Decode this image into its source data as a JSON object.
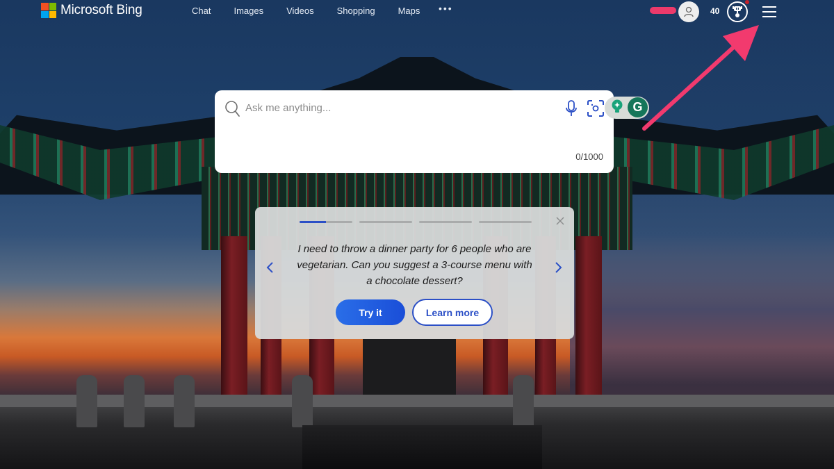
{
  "header": {
    "brand": "Microsoft Bing",
    "logo_colors": [
      "#f25022",
      "#7fba00",
      "#00a4ef",
      "#ffb900"
    ],
    "nav": [
      {
        "label": "Chat"
      },
      {
        "label": "Images"
      },
      {
        "label": "Videos"
      },
      {
        "label": "Shopping"
      },
      {
        "label": "Maps"
      }
    ],
    "more_label": "•••",
    "rewards_points": "40",
    "icons": {
      "avatar": "person-icon",
      "rewards": "trophy-icon",
      "menu": "hamburger-menu-icon"
    }
  },
  "search": {
    "placeholder": "Ask me anything...",
    "value": "",
    "char_count": "0/1000",
    "icons": {
      "search": "search-icon",
      "mic": "microphone-icon",
      "visual": "visual-search-icon"
    }
  },
  "extension": {
    "name": "Grammarly",
    "letter": "G",
    "color": "#15765a"
  },
  "suggestion_card": {
    "step": 1,
    "total_steps": 4,
    "first_step_progress": 0.5,
    "prompt": "I need to throw a dinner party for 6 people who are vegetarian. Can you suggest a 3-course menu with a chocolate dessert?",
    "try_label": "Try it",
    "learn_label": "Learn more",
    "accent_color": "#2b4fc6"
  },
  "annotation": {
    "arrow_color": "#f23a6e",
    "points_to": "hamburger-menu"
  }
}
